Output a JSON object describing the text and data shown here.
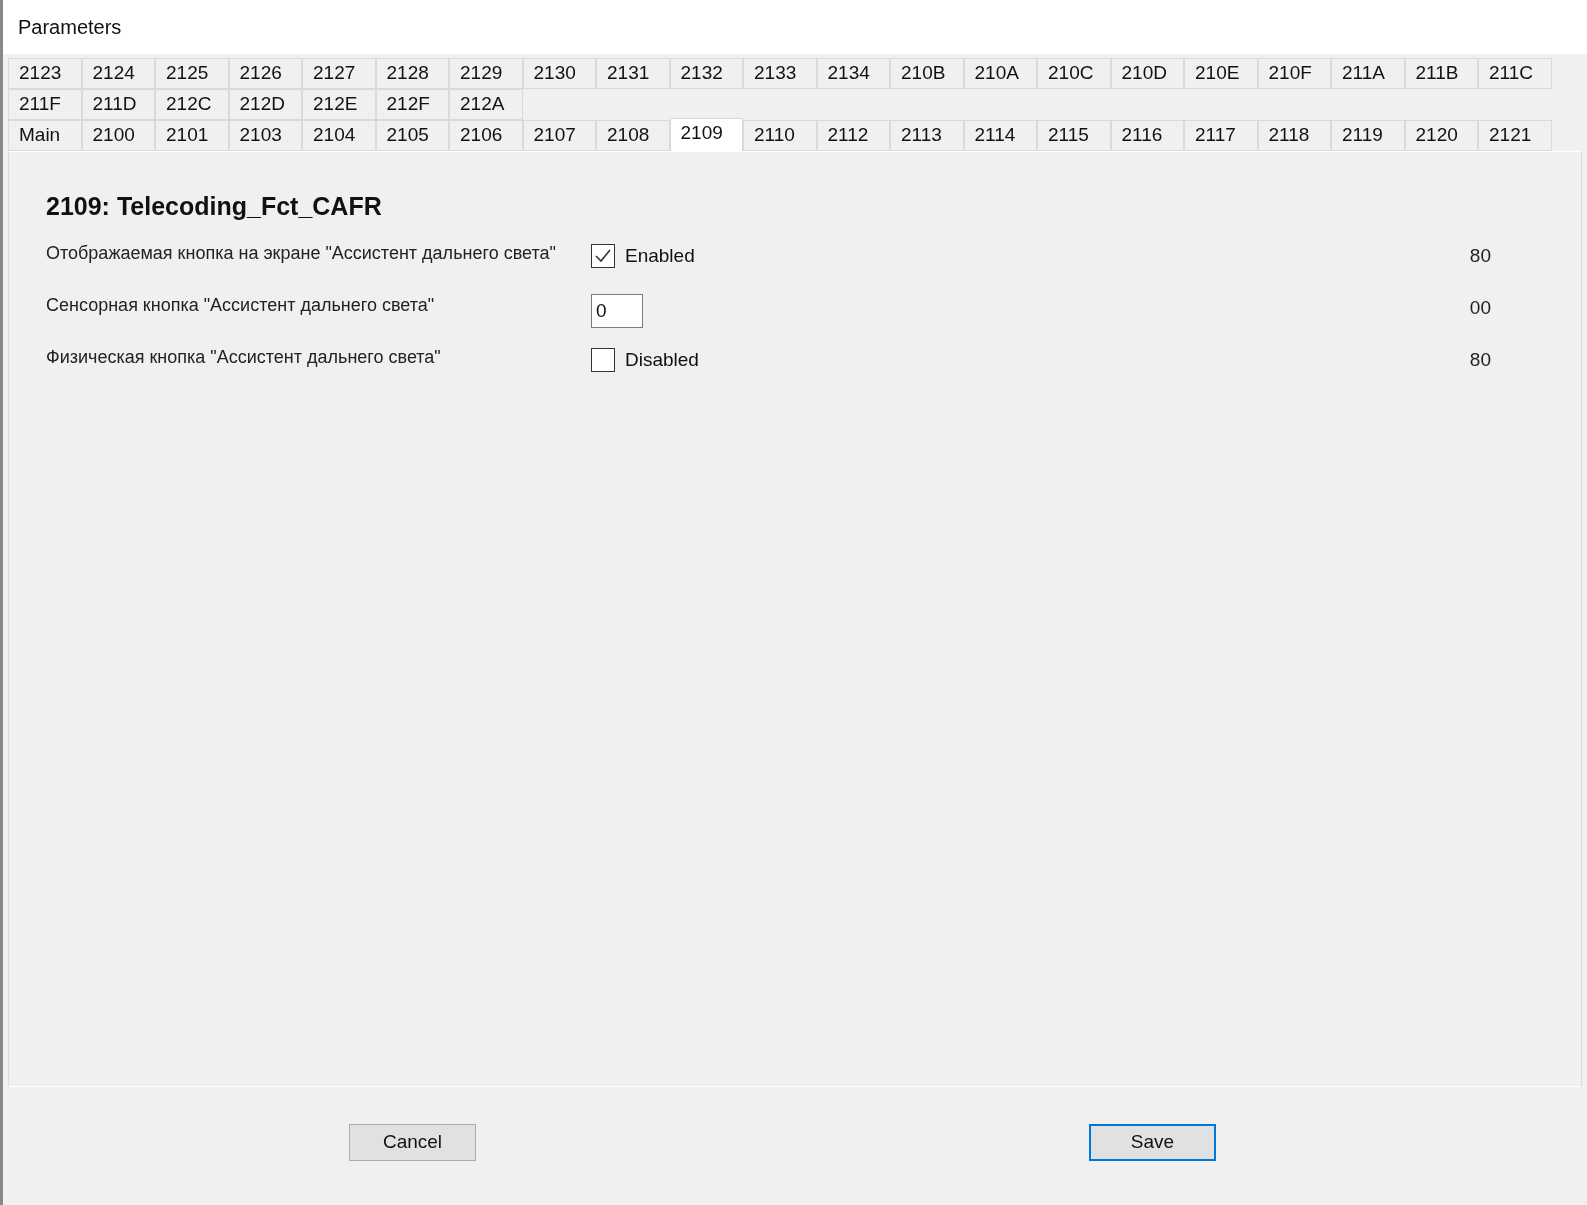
{
  "window": {
    "title": "Parameters"
  },
  "tab_rows": [
    [
      {
        "label": "2123",
        "selected": false
      },
      {
        "label": "2124",
        "selected": false
      },
      {
        "label": "2125",
        "selected": false
      },
      {
        "label": "2126",
        "selected": false
      },
      {
        "label": "2127",
        "selected": false
      },
      {
        "label": "2128",
        "selected": false
      },
      {
        "label": "2129",
        "selected": false
      },
      {
        "label": "2130",
        "selected": false
      },
      {
        "label": "2131",
        "selected": false
      },
      {
        "label": "2132",
        "selected": false
      },
      {
        "label": "2133",
        "selected": false
      },
      {
        "label": "2134",
        "selected": false
      },
      {
        "label": "210B",
        "selected": false
      },
      {
        "label": "210A",
        "selected": false
      },
      {
        "label": "210C",
        "selected": false
      },
      {
        "label": "210D",
        "selected": false
      },
      {
        "label": "210E",
        "selected": false
      },
      {
        "label": "210F",
        "selected": false
      },
      {
        "label": "211A",
        "selected": false
      },
      {
        "label": "211B",
        "selected": false
      },
      {
        "label": "211C",
        "selected": false
      }
    ],
    [
      {
        "label": "211F",
        "selected": false
      },
      {
        "label": "211D",
        "selected": false
      },
      {
        "label": "212C",
        "selected": false
      },
      {
        "label": "212D",
        "selected": false
      },
      {
        "label": "212E",
        "selected": false
      },
      {
        "label": "212F",
        "selected": false
      },
      {
        "label": "212A",
        "selected": false
      }
    ],
    [
      {
        "label": "Main",
        "selected": false
      },
      {
        "label": "2100",
        "selected": false
      },
      {
        "label": "2101",
        "selected": false
      },
      {
        "label": "2103",
        "selected": false
      },
      {
        "label": "2104",
        "selected": false
      },
      {
        "label": "2105",
        "selected": false
      },
      {
        "label": "2106",
        "selected": false
      },
      {
        "label": "2107",
        "selected": false
      },
      {
        "label": "2108",
        "selected": false
      },
      {
        "label": "2109",
        "selected": true
      },
      {
        "label": "2110",
        "selected": false
      },
      {
        "label": "2112",
        "selected": false
      },
      {
        "label": "2113",
        "selected": false
      },
      {
        "label": "2114",
        "selected": false
      },
      {
        "label": "2115",
        "selected": false
      },
      {
        "label": "2116",
        "selected": false
      },
      {
        "label": "2117",
        "selected": false
      },
      {
        "label": "2118",
        "selected": false
      },
      {
        "label": "2119",
        "selected": false
      },
      {
        "label": "2120",
        "selected": false
      },
      {
        "label": "2121",
        "selected": false
      }
    ]
  ],
  "panel": {
    "heading": "2109: Telecoding_Fct_CAFR",
    "fields": [
      {
        "kind": "checkbox",
        "label": "Отображаемая кнопка на экране \"Ассистент дальнего света\"",
        "checked": true,
        "text": "Enabled",
        "code": "80"
      },
      {
        "kind": "input",
        "label": "Сенсорная кнопка \"Ассистент дальнего света\"",
        "value": "0",
        "code": "00"
      },
      {
        "kind": "checkbox",
        "label": "Физическая кнопка \"Ассистент дальнего света\"",
        "checked": false,
        "text": "Disabled",
        "code": "80"
      }
    ]
  },
  "buttons": [
    {
      "kind": "cancel",
      "label": "Cancel"
    },
    {
      "kind": "save",
      "label": "Save"
    }
  ]
}
